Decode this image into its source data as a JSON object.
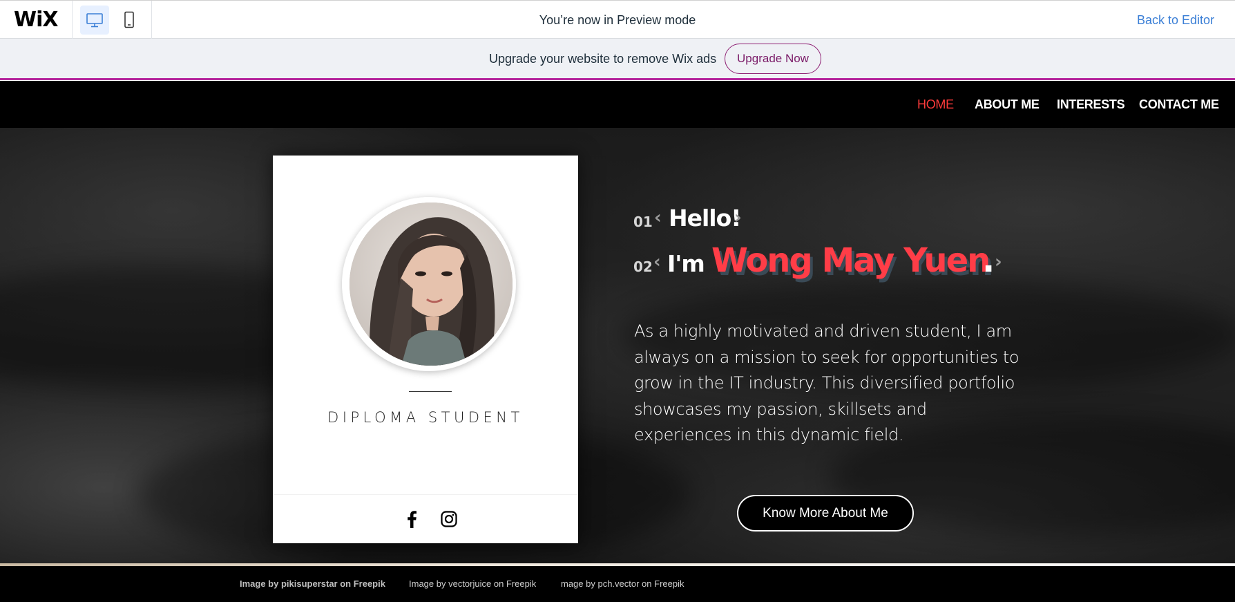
{
  "preview_bar": {
    "logo": "WiX",
    "message": "You’re now in Preview mode",
    "back_to_editor": "Back to Editor",
    "desktop_icon": "desktop-icon",
    "mobile_icon": "mobile-icon"
  },
  "upgrade_banner": {
    "text": "Upgrade your website to remove Wix ads",
    "button": "Upgrade Now",
    "accent": "#b6279d"
  },
  "nav": {
    "items": [
      {
        "label": "HOME",
        "active": true
      },
      {
        "label": "ABOUT ME",
        "active": false
      },
      {
        "label": "INTERESTS",
        "active": false
      },
      {
        "label": "CONTACT ME",
        "active": false
      }
    ],
    "active_color": "#ff3b3b"
  },
  "profile_card": {
    "role": "DIPLOMA STUDENT",
    "social": [
      "facebook-icon",
      "instagram-icon"
    ]
  },
  "hero": {
    "line1_num": "01",
    "line1_text": "Hello!",
    "line2_num": "02",
    "line2_prefix": "I'm",
    "name": "Wong May Yuen",
    "name_suffix": ".",
    "name_color": "#ff3d47",
    "description": "As a highly motivated and driven student, I am always on a mission to seek for opportunities to grow in the IT industry. This diversified portfolio showcases my passion, skillsets and experiences in this dynamic field.",
    "cta": "Know More About Me"
  },
  "footer": {
    "credits": [
      "Image by pikisuperstar on Freepik",
      "Image by vectorjuice on Freepik",
      "mage by pch.vector on Freepik"
    ]
  }
}
